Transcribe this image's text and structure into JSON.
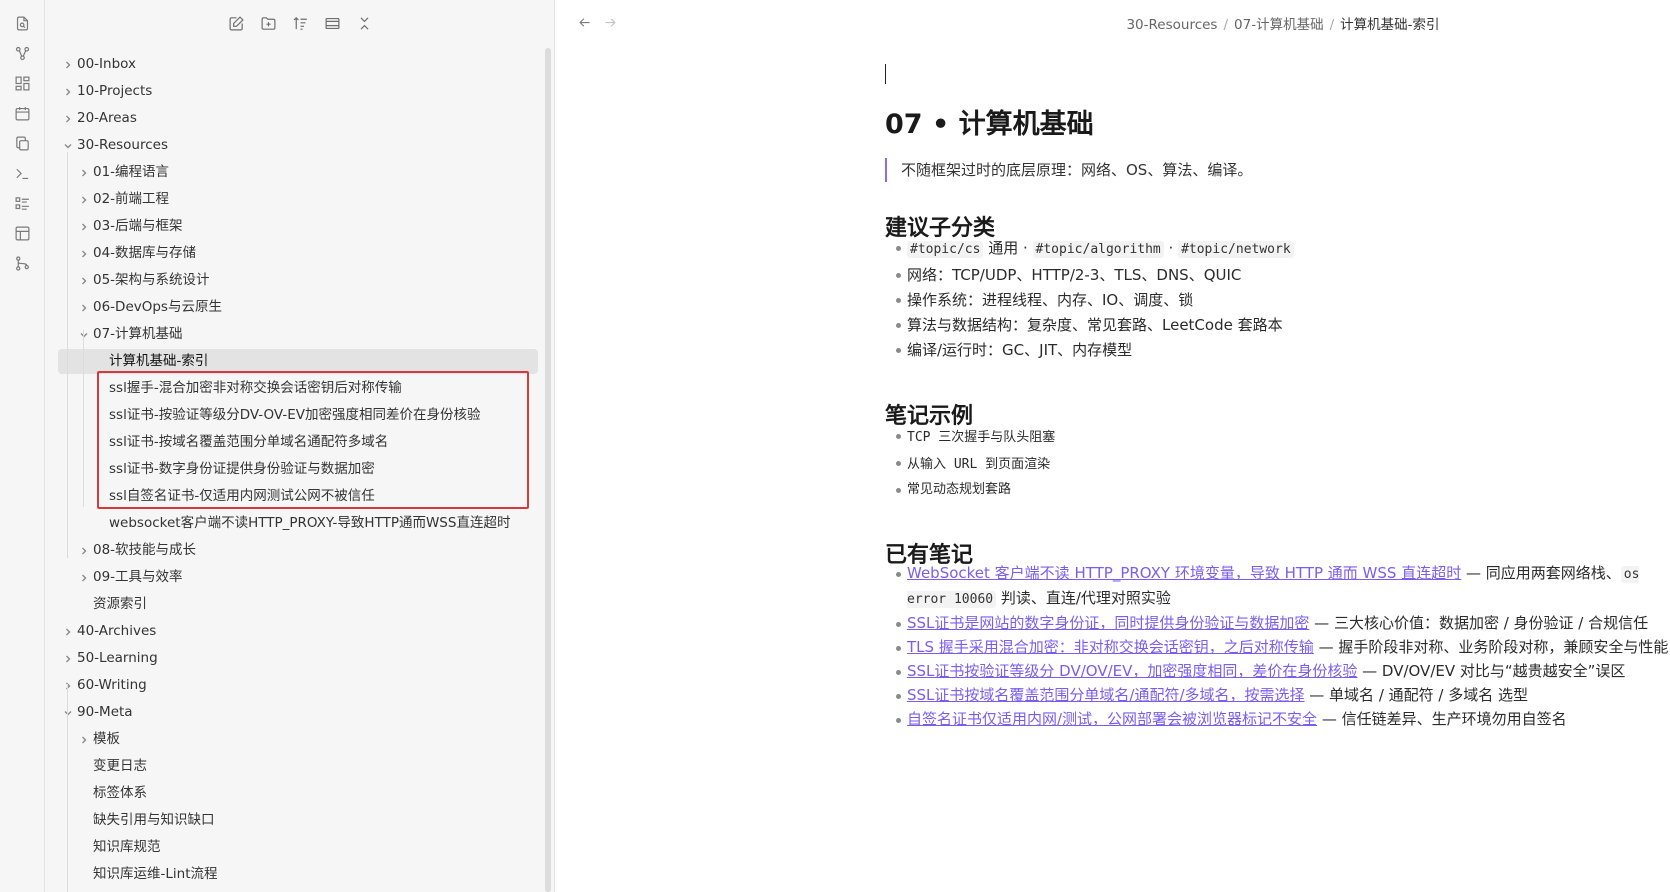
{
  "ribbon": {
    "icons": [
      "open-file-icon",
      "graph-view-icon",
      "canvas-icon",
      "calendar-icon",
      "copy-icon",
      "terminal-icon",
      "list-icon",
      "layout-icon",
      "git-icon"
    ]
  },
  "file_nav": {
    "actions": [
      "new-note-icon",
      "new-folder-icon",
      "sort-icon",
      "collapse-view-icon",
      "collapse-all-icon"
    ],
    "tree": [
      {
        "label": "00-Inbox",
        "depth": 0,
        "type": "folder",
        "expanded": false
      },
      {
        "label": "10-Projects",
        "depth": 0,
        "type": "folder",
        "expanded": false
      },
      {
        "label": "20-Areas",
        "depth": 0,
        "type": "folder",
        "expanded": false
      },
      {
        "label": "30-Resources",
        "depth": 0,
        "type": "folder",
        "expanded": true
      },
      {
        "label": "01-编程语言",
        "depth": 1,
        "type": "folder",
        "expanded": false
      },
      {
        "label": "02-前端工程",
        "depth": 1,
        "type": "folder",
        "expanded": false
      },
      {
        "label": "03-后端与框架",
        "depth": 1,
        "type": "folder",
        "expanded": false
      },
      {
        "label": "04-数据库与存储",
        "depth": 1,
        "type": "folder",
        "expanded": false
      },
      {
        "label": "05-架构与系统设计",
        "depth": 1,
        "type": "folder",
        "expanded": false
      },
      {
        "label": "06-DevOps与云原生",
        "depth": 1,
        "type": "folder",
        "expanded": false
      },
      {
        "label": "07-计算机基础",
        "depth": 1,
        "type": "folder",
        "expanded": true
      },
      {
        "label": "计算机基础-索引",
        "depth": 2,
        "type": "file",
        "active": true
      },
      {
        "label": "ssl握手-混合加密非对称交换会话密钥后对称传输",
        "depth": 2,
        "type": "file"
      },
      {
        "label": "ssl证书-按验证等级分DV-OV-EV加密强度相同差价在身份核验",
        "depth": 2,
        "type": "file"
      },
      {
        "label": "ssl证书-按域名覆盖范围分单域名通配符多域名",
        "depth": 2,
        "type": "file"
      },
      {
        "label": "ssl证书-数字身份证提供身份验证与数据加密",
        "depth": 2,
        "type": "file"
      },
      {
        "label": "ssl自签名证书-仅适用内网测试公网不被信任",
        "depth": 2,
        "type": "file"
      },
      {
        "label": "websocket客户端不读HTTP_PROXY-导致HTTP通而WSS直连超时",
        "depth": 2,
        "type": "file"
      },
      {
        "label": "08-软技能与成长",
        "depth": 1,
        "type": "folder",
        "expanded": false
      },
      {
        "label": "09-工具与效率",
        "depth": 1,
        "type": "folder",
        "expanded": false
      },
      {
        "label": "资源索引",
        "depth": 1,
        "type": "file"
      },
      {
        "label": "40-Archives",
        "depth": 0,
        "type": "folder",
        "expanded": false
      },
      {
        "label": "50-Learning",
        "depth": 0,
        "type": "folder",
        "expanded": false
      },
      {
        "label": "60-Writing",
        "depth": 0,
        "type": "folder",
        "expanded": false
      },
      {
        "label": "90-Meta",
        "depth": 0,
        "type": "folder",
        "expanded": true
      },
      {
        "label": "模板",
        "depth": 1,
        "type": "folder",
        "expanded": false
      },
      {
        "label": "变更日志",
        "depth": 1,
        "type": "file"
      },
      {
        "label": "标签体系",
        "depth": 1,
        "type": "file"
      },
      {
        "label": "缺失引用与知识缺口",
        "depth": 1,
        "type": "file"
      },
      {
        "label": "知识库规范",
        "depth": 1,
        "type": "file"
      },
      {
        "label": "知识库运维-Lint流程",
        "depth": 1,
        "type": "file"
      }
    ]
  },
  "breadcrumb": {
    "parts": [
      "30-Resources",
      "07-计算机基础"
    ],
    "separator": "/",
    "current": "计算机基础-索引"
  },
  "note": {
    "title": "07 • 计算机基础",
    "quote": "不随框架过时的底层原理：网络、OS、算法、编译。",
    "sections": {
      "subcategories": {
        "heading": "建议子分类",
        "tag1": "#topic/cs",
        "tag_mid": " 通用 · ",
        "tag2": "#topic/algorithm",
        "tag_sep": " · ",
        "tag3": "#topic/network",
        "items": [
          "网络：TCP/UDP、HTTP/2-3、TLS、DNS、QUIC",
          "操作系统：进程线程、内存、IO、调度、锁",
          "算法与数据结构：复杂度、常见套路、LeetCode 套路本",
          "编译/运行时：GC、JIT、内存模型"
        ]
      },
      "examples": {
        "heading": "笔记示例",
        "ex1_a": "TCP",
        "ex1_b": " 三次握手与队头阻塞",
        "ex2_a": "从输入 ",
        "ex2_b": "URL",
        "ex2_c": " 到页面渲染",
        "ex3": "常见动态规划套路"
      },
      "existing": {
        "heading": "已有笔记",
        "n1_link": "WebSocket 客户端不读 HTTP_PROXY 环境变量，导致 HTTP 通而 WSS 直连超时",
        "n1_a": " — 同应用两套网络栈、",
        "n1_code": "os error 10060",
        "n1_b": " 判读、直连/代理对照实验",
        "n2_link": "SSL证书是网站的数字身份证，同时提供身份验证与数据加密",
        "n2_desc": " — 三大核心价值：数据加密 / 身份验证 / 合规信任",
        "n3_link": "TLS 握手采用混合加密：非对称交换会话密钥，之后对称传输",
        "n3_desc": " — 握手阶段非对称、业务阶段对称，兼顾安全与性能",
        "n4_link": "SSL证书按验证等级分 DV/OV/EV，加密强度相同，差价在身份核验",
        "n4_desc": " — DV/OV/EV 对比与“越贵越安全”误区",
        "n5_link": "SSL证书按域名覆盖范围分单域名/通配符/多域名，按需选择",
        "n5_desc": " — 单域名 / 通配符 / 多域名 选型",
        "n6_link": "自签名证书仅适用内网/测试，公网部署会被浏览器标记不安全",
        "n6_desc": " — 信任链差异、生产环境勿用自签名"
      }
    }
  },
  "colors": {
    "accent": "#7b5cf0",
    "highlight_box": "#d63b3b",
    "sidebar_bg": "#f6f6f6"
  }
}
